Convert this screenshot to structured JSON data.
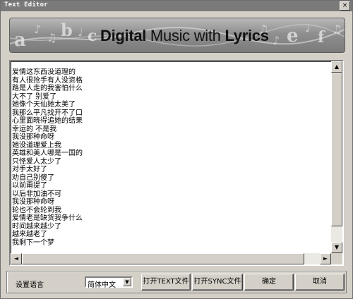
{
  "window": {
    "title": "Text Editor",
    "close_glyph": "×"
  },
  "banner": {
    "title_bold1": "Digital",
    "title_regular": " Music with ",
    "title_bold2": "Lyrics",
    "decor_letters": [
      "a",
      "b",
      "c",
      "e",
      "f"
    ]
  },
  "editor": {
    "lines": [
      "爱情这东西没道理的",
      "有人很抢手有人没资格",
      "路是人走的我害怕什么",
      "大不了 别爱了",
      "她像个天仙她太美了",
      "我那么平凡找开不了口",
      "心里面晓得追她的结果",
      "幸运的 不是我",
      "我没那种命呀",
      "她没道理爱上我",
      "英雄和美人哪是一国的",
      "只怪爱人太少了",
      "对手太好了",
      "劝自己别傻了",
      "以前甭提了",
      "以后非加油不可",
      "我没那种命呀",
      "轮也不会轮到我",
      "爱情老是缺货我争什么",
      "时间越来越少了",
      "越来越老了",
      "我剩下一个梦"
    ]
  },
  "scroll": {
    "up": "▲",
    "down": "▼",
    "left": "◄",
    "right": "►"
  },
  "controls": {
    "language_label": "设置语言",
    "language_value": "简体中文",
    "dropdown_arrow": "▼",
    "open_text_button": "打开TEXT文件",
    "open_sync_button": "打开SYNC文件",
    "ok_button": "确定",
    "cancel_button": "取消"
  }
}
